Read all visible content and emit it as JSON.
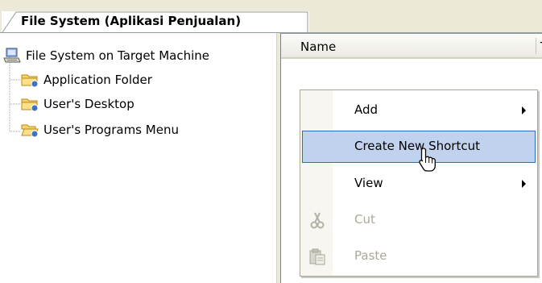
{
  "tab": {
    "title": "File System (Aplikasi Penjualan)"
  },
  "tree": {
    "root": {
      "label": "File System on Target Machine",
      "icon": "computer-icon"
    },
    "children": [
      {
        "label": "Application Folder",
        "icon": "folder-icon"
      },
      {
        "label": "User's Desktop",
        "icon": "folder-icon"
      },
      {
        "label": "User's Programs Menu",
        "icon": "folder-open-icon"
      }
    ]
  },
  "list": {
    "columns": [
      {
        "label": "Name"
      },
      {
        "label": "Ty"
      }
    ]
  },
  "context_menu": {
    "items": [
      {
        "label": "Add",
        "submenu": true,
        "enabled": true
      },
      {
        "label": "Create New Shortcut",
        "submenu": false,
        "enabled": true,
        "highlighted": true
      },
      {
        "label": "View",
        "submenu": true,
        "enabled": true
      },
      {
        "label": "Cut",
        "submenu": false,
        "enabled": false,
        "icon": "scissors-icon"
      },
      {
        "label": "Paste",
        "submenu": false,
        "enabled": false,
        "icon": "clipboard-icon"
      }
    ]
  },
  "colors": {
    "highlight": "#c1d2ee",
    "highlight_border": "#316ac5",
    "disabled_text": "#aca899"
  }
}
